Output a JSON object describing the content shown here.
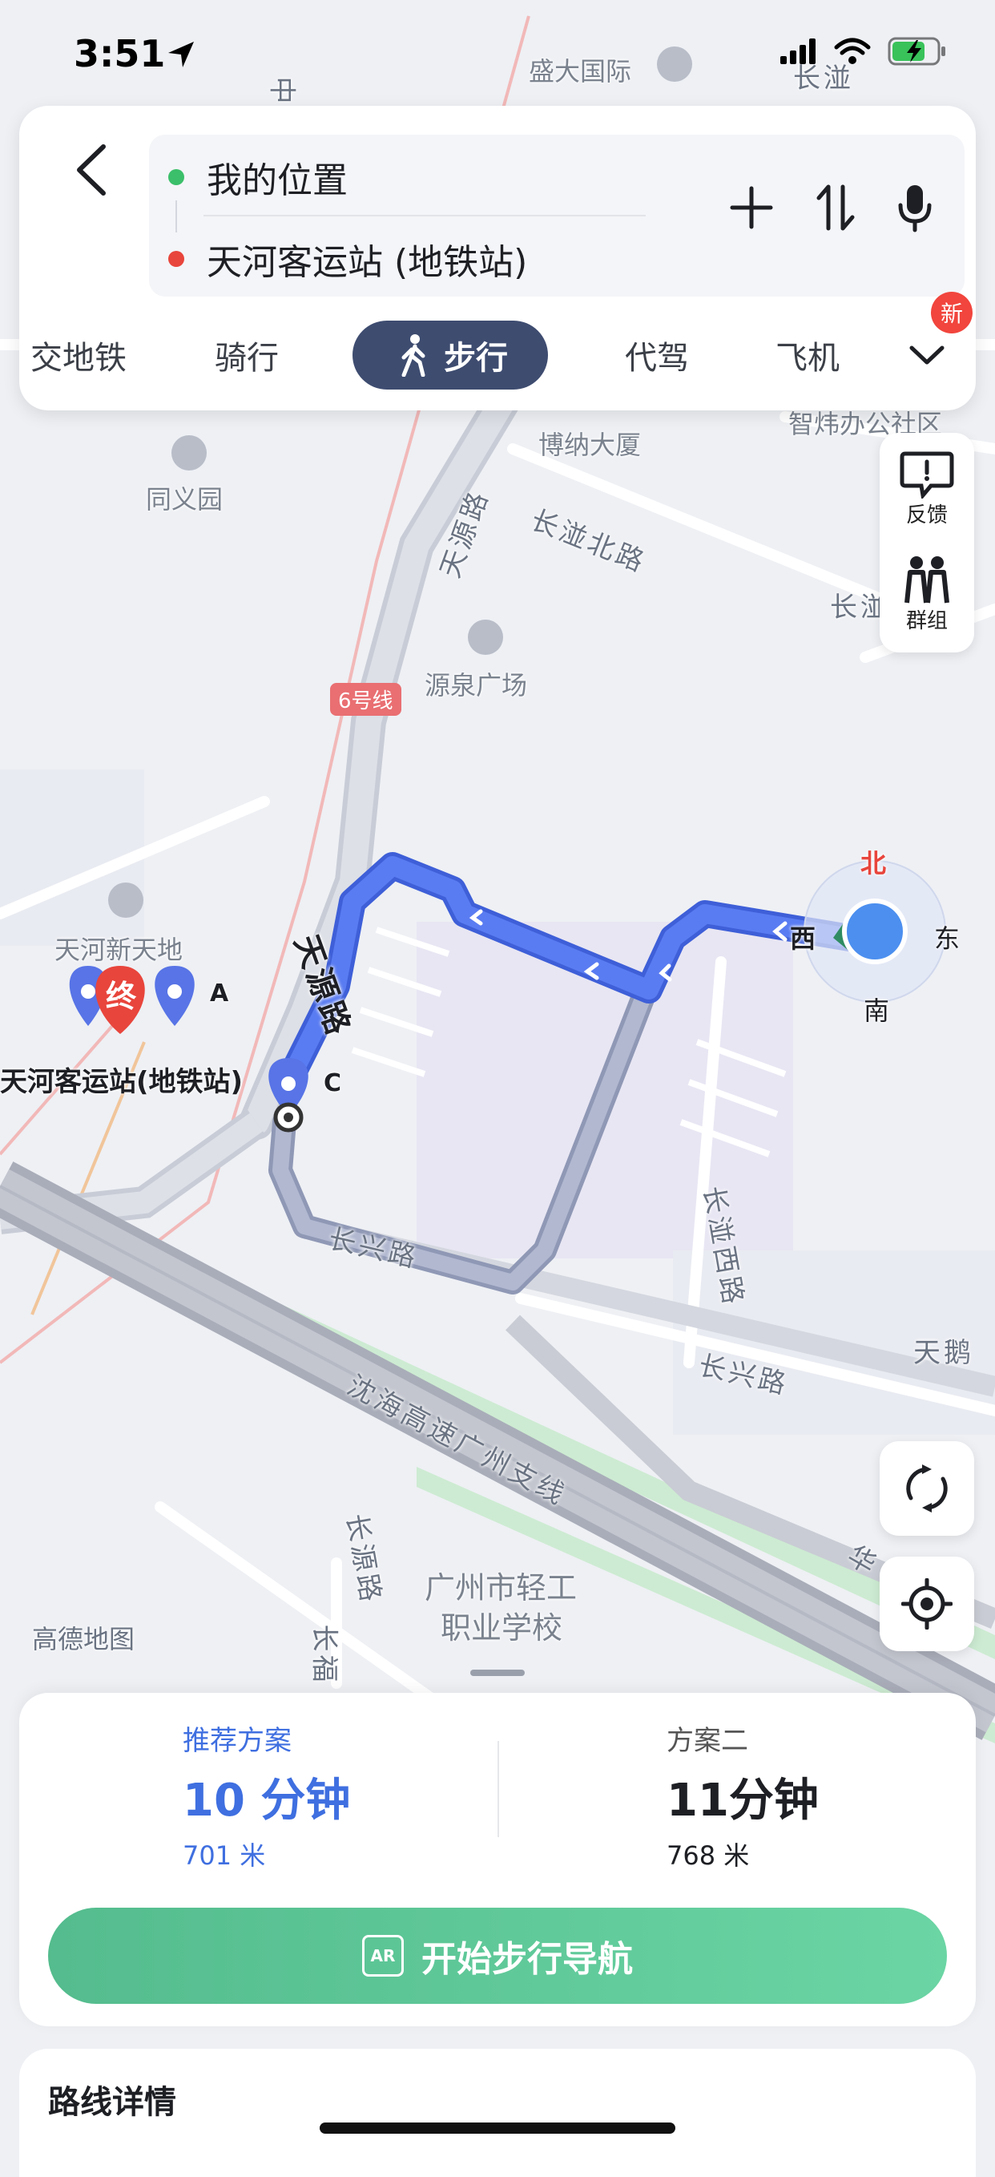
{
  "status": {
    "time": "3:51"
  },
  "route": {
    "origin": "我的位置",
    "destination": "天河客运站 (地铁站)"
  },
  "modes": [
    {
      "label": "交地铁"
    },
    {
      "label": "骑行"
    },
    {
      "label": "步行",
      "active": true
    },
    {
      "label": "代驾"
    },
    {
      "label": "飞机"
    }
  ],
  "new_badge": "新",
  "side_controls": {
    "feedback": "反馈",
    "group": "群组"
  },
  "map": {
    "pois": {
      "shengda": "盛大国际",
      "bona": "博纳大厦",
      "zhiwei": "智炜办公社区",
      "tongyi": "同义园",
      "yuanquan": "源泉广场",
      "tianhe_xintiandi": "天河新天地",
      "station": "天河客运站(地铁站)",
      "school_line1": "广州市轻工",
      "school_line2": "职业学校",
      "watermark": "高德地图"
    },
    "roads": {
      "tianyuan_top": "天源路",
      "tianyuan_route": "天源路",
      "changxing": "长兴路",
      "changxing_2": "长兴路",
      "changban_north": "长湴北路",
      "changban_east": "长湴东",
      "changban_west": "长湴西路",
      "shenhai": "沈海高速广州支线",
      "changyuan": "长源路",
      "changfu": "长福",
      "tiane": "天鹅",
      "hua": "华",
      "zhong": "中",
      "changban_top": "长湴",
      "line6": "6号线"
    },
    "markers": {
      "end": "终",
      "a": "A",
      "c": "C"
    },
    "compass": {
      "north": "北",
      "south": "南",
      "east": "东",
      "west": "西"
    },
    "colors": {
      "route": "#4c72f0",
      "route_alt": "#a8b0c8",
      "end_marker": "#e8453c"
    }
  },
  "plans": [
    {
      "tag": "推荐方案",
      "time": "10 分钟",
      "distance": "701 米",
      "recommended": true
    },
    {
      "tag": "方案二",
      "time": "11分钟",
      "distance": "768 米",
      "recommended": false
    }
  ],
  "start_button": {
    "icon_label": "AR",
    "label": "开始步行导航"
  },
  "details": {
    "title": "路线详情"
  }
}
